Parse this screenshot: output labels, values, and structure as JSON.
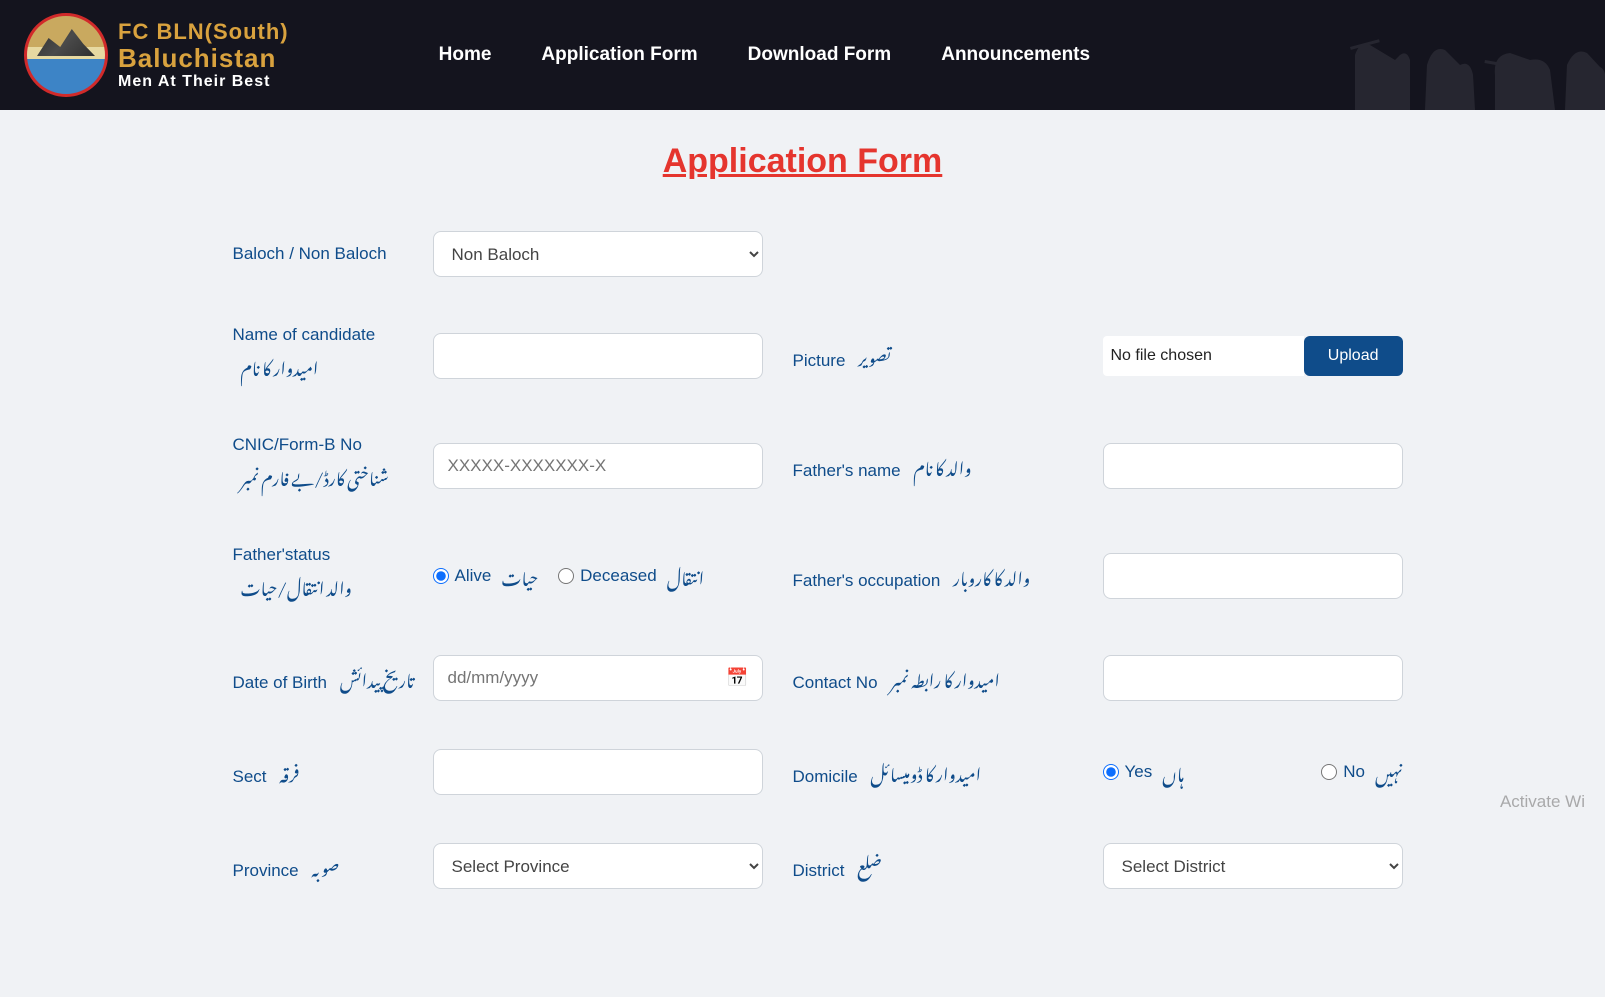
{
  "header": {
    "logo": {
      "line1": "FC BLN(South)",
      "line2": "Baluchistan",
      "line3": "Men At Their Best"
    },
    "nav": {
      "home": "Home",
      "application_form": "Application Form",
      "download_form": "Download Form",
      "announcements": "Announcements"
    }
  },
  "page": {
    "title": "Application Form"
  },
  "form": {
    "baloch": {
      "label_en": "Baloch / Non Baloch",
      "selected": "Non Baloch"
    },
    "candidate_name": {
      "label_en": "Name of candidate",
      "label_ur": "امیدوار کا نام"
    },
    "picture": {
      "label_en": "Picture",
      "label_ur": "تصویر",
      "file_text": "No file chosen",
      "upload_btn": "Upload"
    },
    "cnic": {
      "label_en": "CNIC/Form-B No",
      "label_ur": "شناختی کارڈ/بے فارم نمبر",
      "placeholder": "XXXXX-XXXXXXX-X"
    },
    "father_name": {
      "label_en": "Father's name",
      "label_ur": "والد کا نام"
    },
    "father_status": {
      "label_en": "Father'status",
      "label_ur": "والد انتقال/حیات",
      "alive_en": "Alive",
      "alive_ur": "حیات",
      "deceased_en": "Deceased",
      "deceased_ur": "انتقال"
    },
    "father_occupation": {
      "label_en": "Father's occupation",
      "label_ur": "والد کا کاروبار"
    },
    "dob": {
      "label_en": "Date of Birth",
      "label_ur": "تاریخ پیدائش",
      "placeholder": "dd/mm/yyyy"
    },
    "contact": {
      "label_en": "Contact No",
      "label_ur": "امیدوار کا رابطہ نمبر"
    },
    "sect": {
      "label_en": "Sect",
      "label_ur": "فرقہ"
    },
    "domicile": {
      "label_en": "Domicile",
      "label_ur": "امیدوار کا ڈومیسائل",
      "yes_en": "Yes",
      "yes_ur": "ہاں",
      "no_en": "No",
      "no_ur": "نہیں"
    },
    "province": {
      "label_en": "Province",
      "label_ur": "صوبہ",
      "selected": "Select Province"
    },
    "district": {
      "label_en": "District",
      "label_ur": "ضلع",
      "selected": "Select District"
    }
  },
  "watermark": "Activate Wi"
}
